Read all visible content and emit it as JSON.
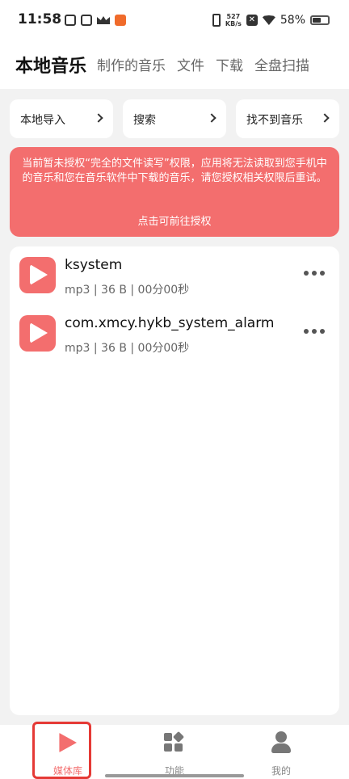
{
  "status_bar": {
    "time": "11:58",
    "net_speed_value": "527",
    "net_speed_unit": "KB/s",
    "battery": "58%"
  },
  "header": {
    "tabs": [
      "本地音乐",
      "制作的音乐",
      "文件",
      "下载",
      "全盘扫描"
    ]
  },
  "actions": {
    "local_import": "本地导入",
    "search": "搜索",
    "cant_find": "找不到音乐"
  },
  "warning": {
    "message": "当前暂未授权“完全的文件读写”权限，应用将无法读取到您手机中的音乐和您在音乐软件中下载的音乐，请您授权相关权限后重试。",
    "link": "点击可前往授权"
  },
  "songs": [
    {
      "title": "ksystem",
      "meta": "mp3 | 36 B | 00分00秒"
    },
    {
      "title": "com.xmcy.hykb_system_alarm",
      "meta": "mp3 | 36 B | 00分00秒"
    }
  ],
  "nav": {
    "media_library": "媒体库",
    "functions": "功能",
    "mine": "我的"
  },
  "colors": {
    "accent": "#f36e6e",
    "highlight": "#e53935"
  }
}
